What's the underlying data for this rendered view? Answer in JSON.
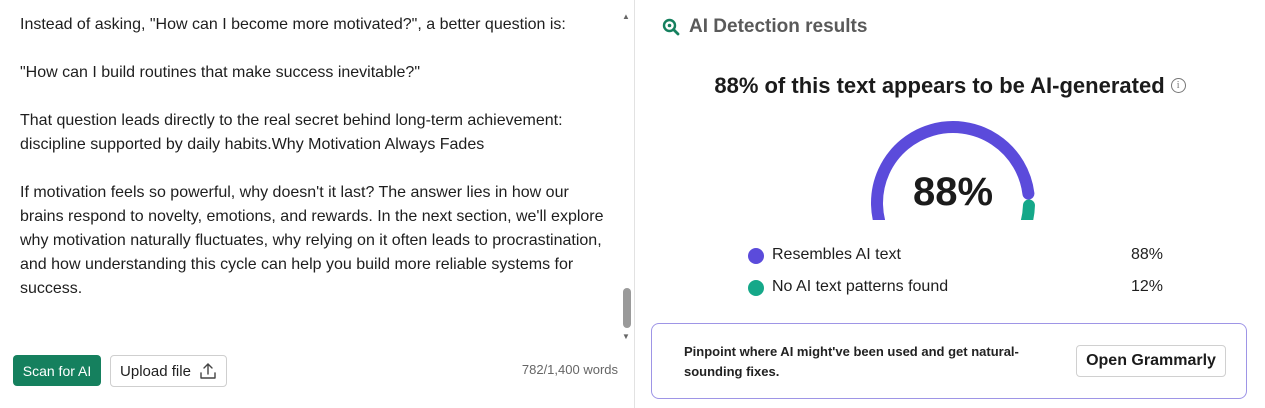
{
  "editor": {
    "paragraphs": [
      "Instead of asking, \"How can I become more motivated?\", a better question is:",
      "\"How can I build routines that make success inevitable?\"",
      "That question leads directly to the real secret behind long-term achievement: discipline supported by daily habits.Why Motivation Always Fades",
      "If motivation feels so powerful, why doesn't it last? The answer lies in how our brains respond to novelty, emotions, and rewards. In the next section, we'll explore why motivation naturally fluctuates, why relying on it often leads to procrastination, and how understanding this cycle can help you build more reliable systems for success."
    ],
    "word_count": "782/1,400 words"
  },
  "toolbar": {
    "scan_label": "Scan for AI",
    "upload_label": "Upload file"
  },
  "results": {
    "title": "AI Detection results",
    "headline": "88% of this text appears to be AI-generated",
    "gauge_value": "88%",
    "ai_fraction": 0.88,
    "legend": [
      {
        "label": "Resembles AI text",
        "percent": "88%",
        "color": "#5b4bdb"
      },
      {
        "label": "No AI text patterns found",
        "percent": "12%",
        "color": "#15a889"
      }
    ]
  },
  "cta": {
    "text": "Pinpoint where AI might've been used and get natural-sounding fixes.",
    "button_label": "Open Grammarly"
  },
  "colors": {
    "accent_green": "#15805e",
    "ai_purple": "#5b4bdb",
    "human_teal": "#15a889",
    "cta_border": "#9e95e6"
  }
}
